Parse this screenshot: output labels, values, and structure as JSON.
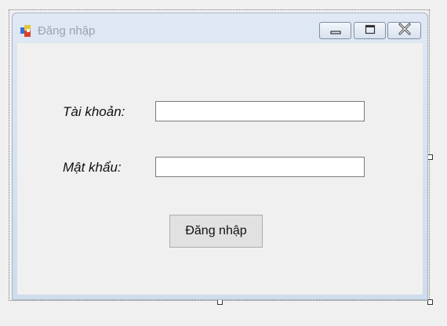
{
  "window": {
    "title": "Đăng nhập"
  },
  "form": {
    "account_label": "Tài khoản:",
    "account_value": "",
    "password_label": "Mật khẩu:",
    "password_value": "",
    "login_button_label": "Đăng nhập"
  },
  "icons": {
    "app": "app-icon",
    "minimize": "minimize-icon",
    "maximize": "maximize-icon",
    "close": "close-icon"
  },
  "colors": {
    "client_background": "#f0f0f0",
    "title_text": "#9aa3ad",
    "button_background": "#e1e1e1"
  }
}
